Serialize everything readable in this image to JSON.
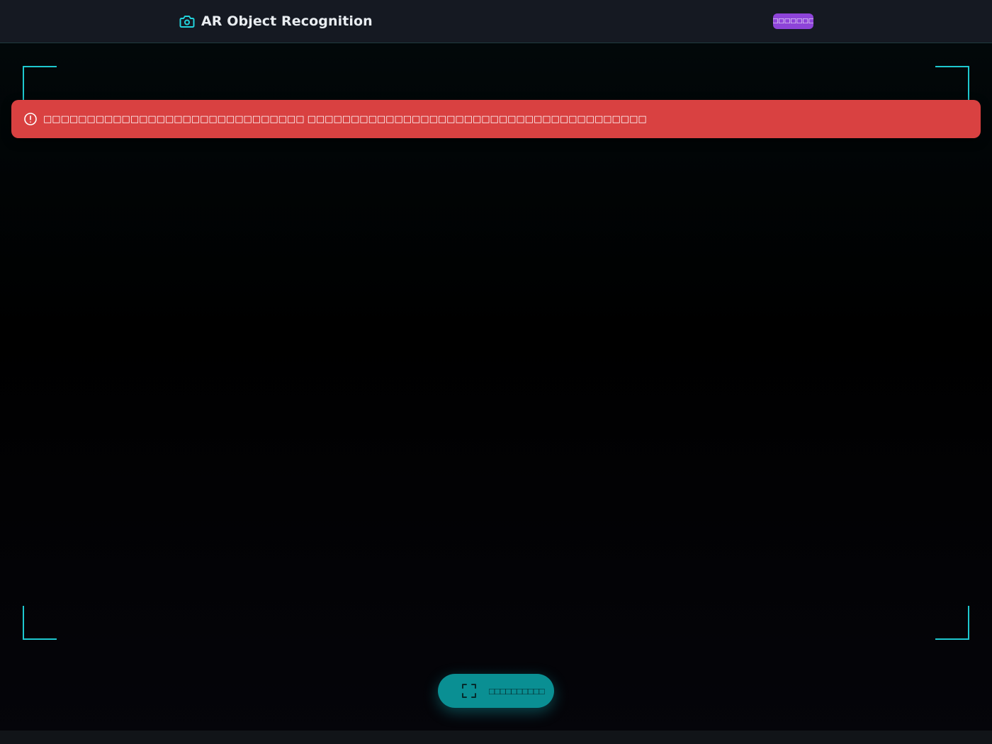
{
  "header": {
    "title": "AR Object Recognition",
    "icon": "camera-icon",
    "badge": "□□□□□□□"
  },
  "alert": {
    "icon": "alert-circle-icon",
    "message": "□□□□□□□□□□□□□□□□□□□□□□□□□□□□□□ □□□□□□□□□□□□□□□□□□□□□□□□□□□□□□□□□□□□□□□"
  },
  "viewfinder": {
    "frame_color": "#1ec8cf"
  },
  "scan_button": {
    "icon": "scan-frame-icon",
    "label": "□□□□□□□□□□"
  },
  "colors": {
    "accent": "#1ec8cf",
    "badge": "#8e44d9",
    "error": "#d94141",
    "button": "#0a8f93"
  }
}
